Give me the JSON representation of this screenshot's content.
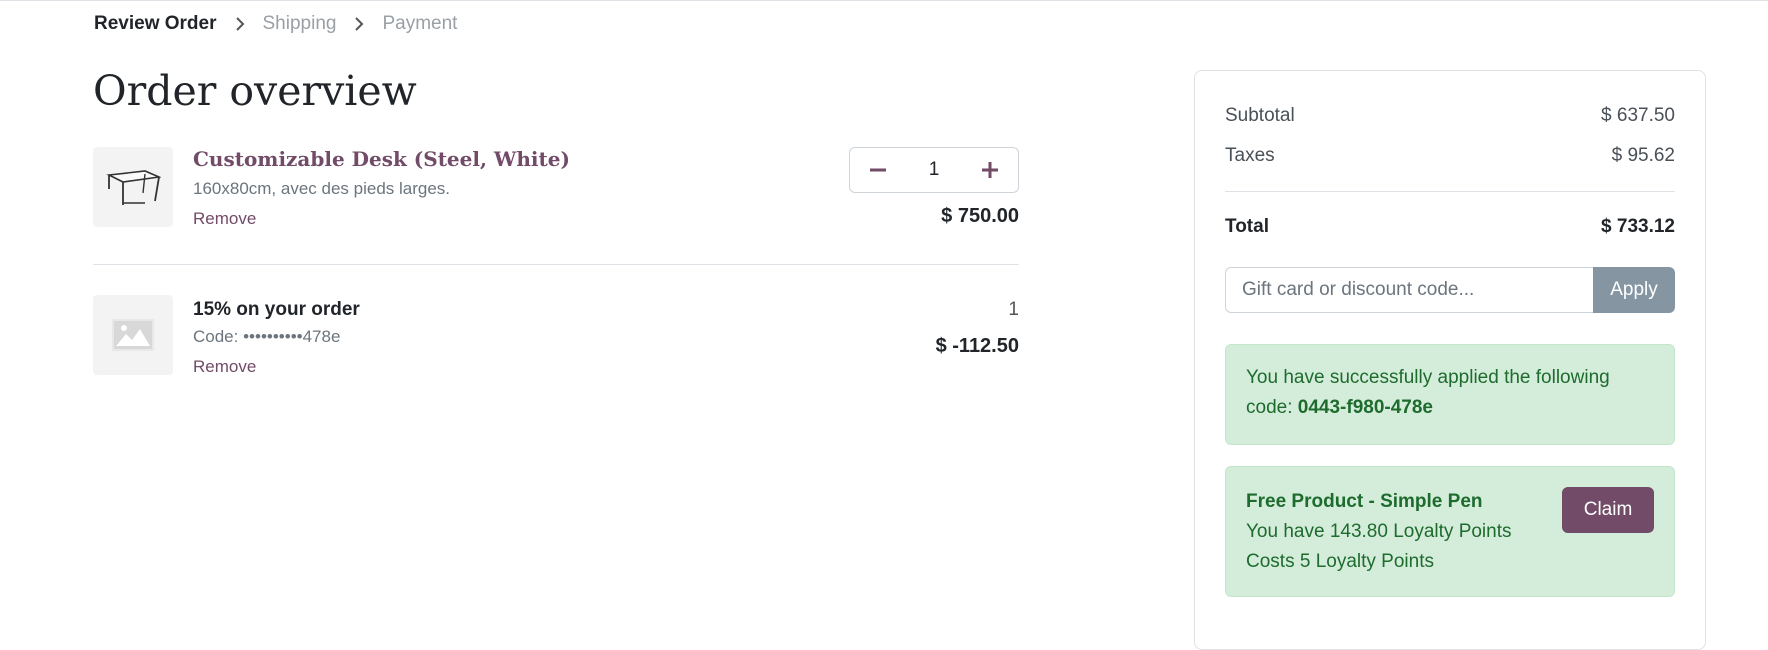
{
  "breadcrumb": {
    "steps": [
      "Review Order",
      "Shipping",
      "Payment"
    ]
  },
  "page": {
    "title": "Order overview"
  },
  "order_lines": [
    {
      "name": "Customizable Desk (Steel, White)",
      "description": "160x80cm, avec des pieds larges.",
      "remove_label": "Remove",
      "quantity": "1",
      "price": "$ 750.00",
      "icon": "desk-thumbnail"
    },
    {
      "name": "15% on your order",
      "code": "Code: ••••••••••478e",
      "remove_label": "Remove",
      "quantity": "1",
      "price": "$ -112.50",
      "icon": "image-placeholder-icon"
    }
  ],
  "summary": {
    "subtotal_label": "Subtotal",
    "subtotal_value": "$ 637.50",
    "taxes_label": "Taxes",
    "taxes_value": "$ 95.62",
    "total_label": "Total",
    "total_value": "$ 733.12",
    "promo_placeholder": "Gift card or discount code...",
    "apply_label": "Apply",
    "success_text": "You have successfully applied the following code:",
    "success_code": "0443-f980-478e",
    "reward_title": "Free Product - Simple Pen",
    "reward_points": "You have 143.80 Loyalty Points",
    "reward_cost": "Costs 5 Loyalty Points",
    "claim_label": "Claim"
  },
  "colors": {
    "brand": "#714b67",
    "apply_button": "#8595a2",
    "success_bg": "#d4edda",
    "success_text": "#1e6b2e"
  }
}
